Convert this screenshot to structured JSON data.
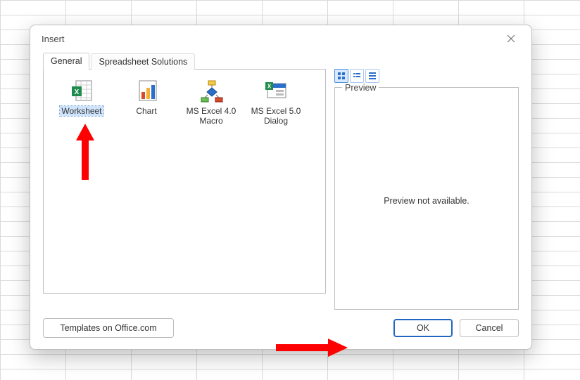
{
  "dialog": {
    "title": "Insert",
    "tabs": [
      {
        "label": "General",
        "active": true
      },
      {
        "label": "Spreadsheet Solutions",
        "active": false
      }
    ]
  },
  "templates": [
    {
      "label": "Worksheet",
      "icon": "excel-worksheet",
      "selected": true
    },
    {
      "label": "Chart",
      "icon": "chart",
      "selected": false
    },
    {
      "label": "MS Excel 4.0 Macro",
      "icon": "macro",
      "selected": false
    },
    {
      "label": "MS Excel 5.0 Dialog",
      "icon": "dialog",
      "selected": false
    }
  ],
  "view_buttons": [
    "large-icons",
    "list",
    "details"
  ],
  "preview": {
    "group_label": "Preview",
    "message": "Preview not available."
  },
  "footer": {
    "templates_button": "Templates on Office.com",
    "ok": "OK",
    "cancel": "Cancel"
  }
}
